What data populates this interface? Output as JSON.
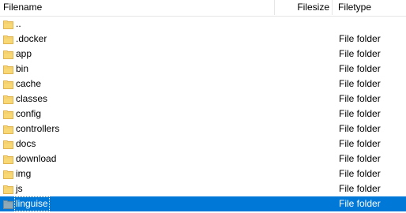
{
  "header": {
    "filename_label": "Filename",
    "filesize_label": "Filesize",
    "filetype_label": "Filetype"
  },
  "colors": {
    "folder": "#f8d775",
    "folder_dark": "#e0b450",
    "selection": "#0078d7"
  },
  "rows": [
    {
      "name": "..",
      "type": ""
    },
    {
      "name": ".docker",
      "type": "File folder"
    },
    {
      "name": "app",
      "type": "File folder"
    },
    {
      "name": "bin",
      "type": "File folder"
    },
    {
      "name": "cache",
      "type": "File folder"
    },
    {
      "name": "classes",
      "type": "File folder"
    },
    {
      "name": "config",
      "type": "File folder"
    },
    {
      "name": "controllers",
      "type": "File folder"
    },
    {
      "name": "docs",
      "type": "File folder"
    },
    {
      "name": "download",
      "type": "File folder"
    },
    {
      "name": "img",
      "type": "File folder"
    },
    {
      "name": "js",
      "type": "File folder"
    },
    {
      "name": "linguise",
      "type": "File folder",
      "selected": true
    }
  ]
}
